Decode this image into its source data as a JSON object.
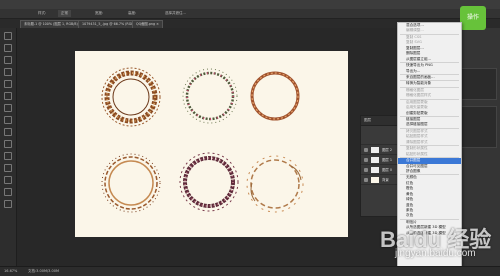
{
  "topbar": {
    "label_a": "样式:",
    "label_b": "正常",
    "label_c": "宽度:",
    "label_d": "高度:",
    "button": "选择并遮住..."
  },
  "tabs": [
    {
      "label": "未标题-1 @ 100% (图层 1, RGB/8) ×"
    },
    {
      "label": "1079431_5_.jpg @ 66.7% (RGB/8) ×"
    },
    {
      "label": "QQ截图.png ×"
    }
  ],
  "status": {
    "zoom": "16.67%",
    "doc": "文档:3.00M/3.00M"
  },
  "layers": {
    "title": "图层",
    "rows": [
      {
        "name": "图层 2"
      },
      {
        "name": "图层 1"
      },
      {
        "name": "图层 0"
      },
      {
        "name": "背景"
      }
    ]
  },
  "context_menu": {
    "items": [
      {
        "label": "混合选项...",
        "state": "normal"
      },
      {
        "label": "编辑调整...",
        "state": "disabled"
      },
      {
        "sep": true
      },
      {
        "label": "复制 CSS",
        "state": "disabled"
      },
      {
        "label": "复制 SVG",
        "state": "disabled"
      },
      {
        "label": "复制图层...",
        "state": "normal"
      },
      {
        "label": "删除图层",
        "state": "normal"
      },
      {
        "label": "从图层建立组...",
        "state": "normal"
      },
      {
        "sep": true
      },
      {
        "label": "快速导出为 PNG",
        "state": "normal"
      },
      {
        "label": "导出为...",
        "state": "normal"
      },
      {
        "sep": true
      },
      {
        "label": "来自图层的画板...",
        "state": "normal"
      },
      {
        "sep": true
      },
      {
        "label": "转换为智能对象",
        "state": "normal"
      },
      {
        "sep": true
      },
      {
        "label": "栅格化图层",
        "state": "disabled"
      },
      {
        "label": "栅格化图层样式",
        "state": "disabled"
      },
      {
        "sep": true
      },
      {
        "label": "启用图层蒙版",
        "state": "disabled"
      },
      {
        "label": "启用矢量蒙版",
        "state": "disabled"
      },
      {
        "label": "创建剪贴蒙版",
        "state": "normal"
      },
      {
        "sep": true
      },
      {
        "label": "链接图层",
        "state": "normal"
      },
      {
        "label": "选择链接图层",
        "state": "normal"
      },
      {
        "sep": true
      },
      {
        "label": "拷贝图层样式",
        "state": "disabled"
      },
      {
        "label": "粘贴图层样式",
        "state": "disabled"
      },
      {
        "label": "清除图层样式",
        "state": "disabled"
      },
      {
        "sep": true
      },
      {
        "label": "复制形状属性",
        "state": "disabled"
      },
      {
        "label": "粘贴形状属性",
        "state": "disabled"
      },
      {
        "sep": true
      },
      {
        "label": "合并图层",
        "state": "selected"
      },
      {
        "label": "合并可见图层",
        "state": "normal"
      },
      {
        "label": "拼合图像",
        "state": "normal"
      },
      {
        "sep": true
      },
      {
        "label": "无颜色",
        "state": "normal"
      },
      {
        "label": "红色",
        "state": "normal"
      },
      {
        "label": "橙色",
        "state": "normal"
      },
      {
        "label": "黄色",
        "state": "normal"
      },
      {
        "label": "绿色",
        "state": "normal"
      },
      {
        "label": "蓝色",
        "state": "normal"
      },
      {
        "label": "紫色",
        "state": "normal"
      },
      {
        "label": "灰色",
        "state": "normal"
      },
      {
        "sep": true
      },
      {
        "label": "明信片",
        "state": "normal"
      },
      {
        "label": "从所选图层新建 3D 模型",
        "state": "normal"
      },
      {
        "label": "从当前选区新建 3D 模型",
        "state": "normal"
      }
    ]
  },
  "badge": {
    "label": "操作"
  },
  "watermark": {
    "main": "Baidu 经验",
    "sub": "jingyan.baidu.com"
  },
  "colors": {
    "menu_highlight": "#3b78d6",
    "canvas": "#fbf6e9",
    "workspace": "#282828"
  }
}
